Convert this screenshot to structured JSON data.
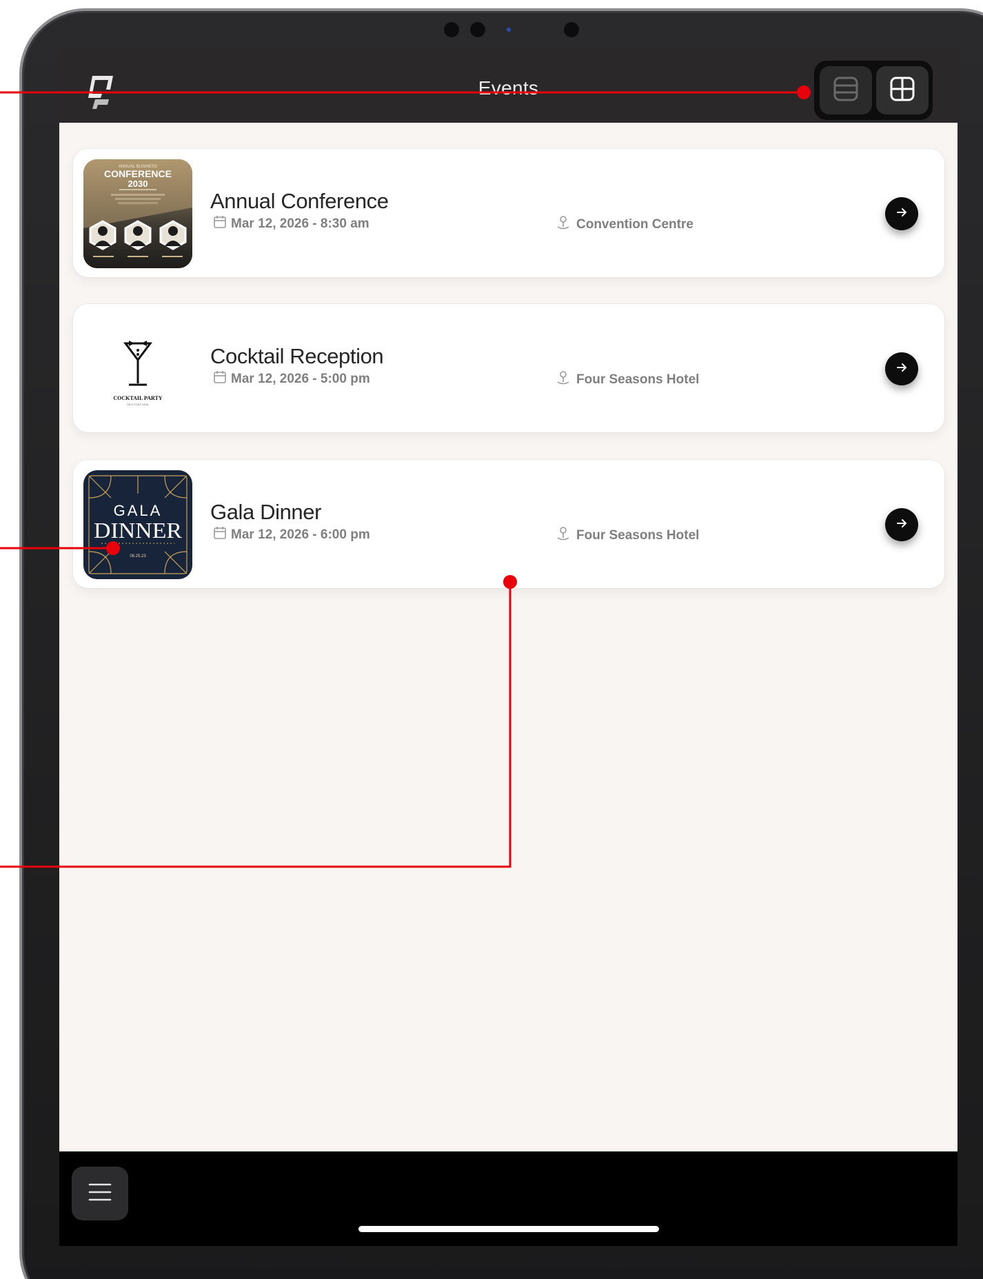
{
  "header": {
    "title": "Events",
    "logo_icon": "app-logo-icon",
    "view_list_icon": "list-view-icon",
    "view_grid_icon": "grid-view-icon"
  },
  "events": [
    {
      "title": "Annual Conference",
      "date": "Mar 12, 2026 - 8:30 am",
      "venue": "Convention Centre",
      "thumb": {
        "kicker": "ANNUAL BUSINESS",
        "heading": "CONFERENCE",
        "year": "2030"
      }
    },
    {
      "title": "Cocktail Reception",
      "date": "Mar 12, 2026 - 5:00 pm",
      "venue": "Four Seasons Hotel",
      "thumb": {
        "heading": "COCKTAIL PARTY",
        "sub": "INVITATION"
      }
    },
    {
      "title": "Gala Dinner",
      "date": "Mar 12, 2026 - 6:00 pm",
      "venue": "Four Seasons Hotel",
      "thumb": {
        "line1": "GALA",
        "line2": "DINNER",
        "date": "06.25.23"
      }
    }
  ],
  "icons": {
    "date": "calendar-icon",
    "venue": "location-pin-icon",
    "go": "arrow-right-icon",
    "menu": "hamburger-menu-icon"
  },
  "colors": {
    "header_bg": "#2b2829",
    "screen_bg": "#f8f5f2",
    "callout": "#e8000b",
    "button_dark": "#0d0d0d"
  }
}
